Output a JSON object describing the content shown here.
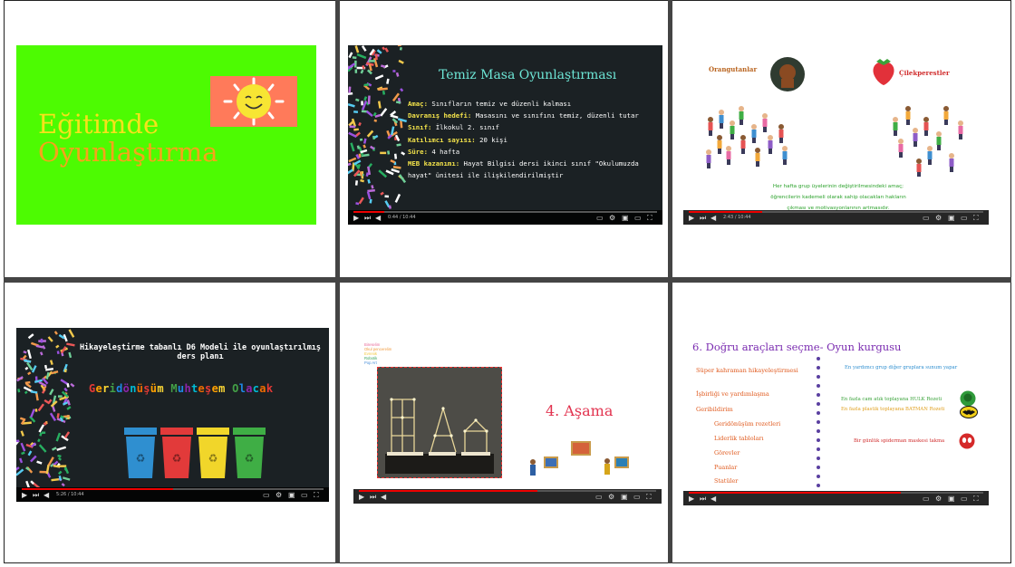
{
  "slide1": {
    "title_line1": "Eğitimde",
    "title_line2": "Oyunlaştırma",
    "bg_color": "#4dfb02"
  },
  "slide2": {
    "title": "Temiz Masa Oyunlaştırması",
    "rows": [
      {
        "label": "Amaç:",
        "text": "Sınıfların temiz ve düzenli kalması"
      },
      {
        "label": "Davranış hedefi:",
        "text": "Masasını ve sınıfını temiz, düzenli tutar"
      },
      {
        "label": "Sınıf:",
        "text": "İlkokul 2. sınıf"
      },
      {
        "label": "Katılımcı sayısı:",
        "text": "20 kişi"
      },
      {
        "label": "Süre:",
        "text": "4 hafta"
      },
      {
        "label": "MEB kazanımı:",
        "text": "Hayat Bilgisi dersi ikinci sınıf \"Okulumuzda"
      },
      {
        "label": "",
        "text": "hayat\" ünitesi ile ilişkilendirilmiştir"
      }
    ],
    "time": "0:44 / 10:44"
  },
  "slide3": {
    "group_left": "Orangutanlar",
    "group_right": "Çilekperestler",
    "caption_lines": [
      "Her hafta grup üyelerinin değiştirilmesindeki amaç;",
      "öğrencilerin kademeli olarak sahip olacakları hakların",
      "çıkması ve motivasyonlarının artmasıdır."
    ],
    "time": "2:43 / 10:44"
  },
  "slide4": {
    "title_line1": "Hikayeleştirme tabanlı D6 Modeli ile oyunlaştırılmış",
    "title_line2": "ders planı",
    "headline": "Geridönüşüm Muhteşem Olacak",
    "headline_colors": [
      "#e53935",
      "#ffa000",
      "#fdd835",
      "#43a047",
      "#1e88e5",
      "#8e24aa",
      "#00bcd4",
      "#ef6c00"
    ],
    "bin_colors": [
      "#2f8fd0",
      "#e23a3a",
      "#f1d62a",
      "#3fae45"
    ],
    "time": "5:26 / 10:44"
  },
  "slide5": {
    "menu": [
      {
        "text": "Bireselim",
        "color": "#e96a9a"
      },
      {
        "text": "Okul pencerelim",
        "color": "#f09b3f"
      },
      {
        "text": "Evrenik",
        "color": "#f3c83c"
      },
      {
        "text": "Robotik",
        "color": "#3ba55a"
      },
      {
        "text": "Pop Art",
        "color": "#4a90d9"
      }
    ],
    "step": "4. Aşama"
  },
  "slide6": {
    "title": "6. Doğru araçları seçme- Oyun kurgusu",
    "left_items": [
      "Süper kahraman hikayeleştirmesi",
      "İşbirliği ve yardımlaşma",
      "Geribildirim"
    ],
    "sub_items": [
      "Geridönüşüm rozetleri",
      "Liderlik tabloları",
      "Görevler",
      "Puanlar",
      "Statüler"
    ],
    "right_items": [
      {
        "text": "En yardımcı grup diğer gruplara sunum yapar",
        "color": "#2f8fd0"
      },
      {
        "text": "En fazla cam atık toplayana HULK Rozeti",
        "color": "#3aa33a"
      },
      {
        "text": "En fazla plastik toplayana BATMAN Rozeti",
        "color": "#e0a020"
      },
      {
        "text": "Bir günlük spiderman maskesi takma",
        "color": "#d02c2c"
      }
    ]
  }
}
